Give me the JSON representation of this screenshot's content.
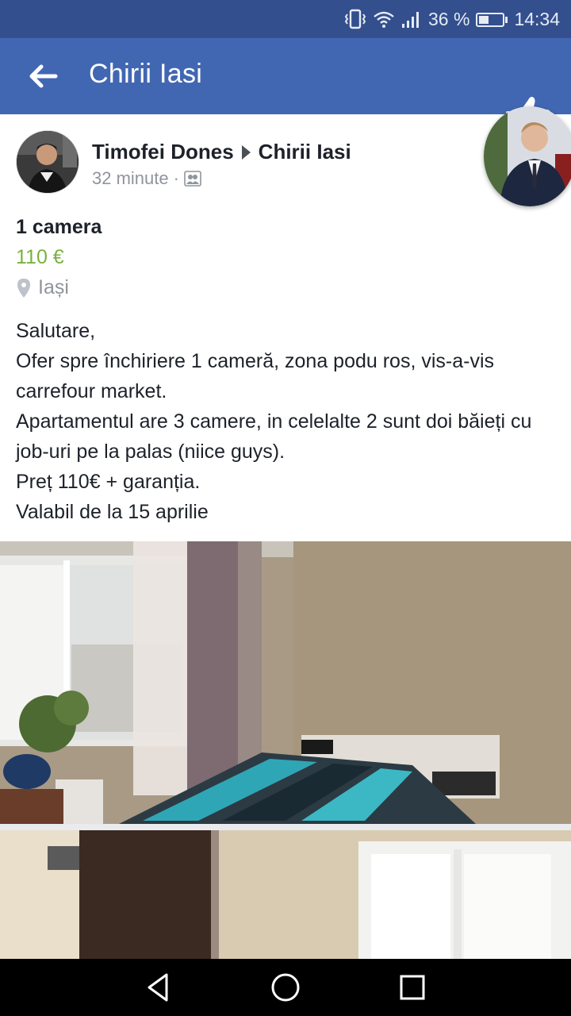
{
  "status_bar": {
    "battery_text": "36 %",
    "battery_level": 0.36,
    "time": "14:34"
  },
  "app_bar": {
    "title": "Chirii Iasi"
  },
  "post": {
    "author": "Timofei Dones",
    "group": "Chirii Iasi",
    "timestamp": "32 minute",
    "separator": "·",
    "privacy_icon": "group-icon"
  },
  "listing": {
    "title": "1 camera",
    "price": "110 €",
    "location": "Iași",
    "price_color": "#78b23f"
  },
  "body_lines": [
    "Salutare,",
    "Ofer spre închiriere 1 cameră, zona podu ros, vis-a-vis carrefour market.",
    "Apartamentul are 3 camere, in celelalte 2 sunt doi băieți cu job-uri pe la palas (niice guys).",
    "Preț 110€ + garanția.",
    "Valabil de la 15 aprilie"
  ],
  "colors": {
    "status_bar": "#334f8d",
    "app_bar": "#4267b2",
    "text": "#1d2129",
    "muted": "#90949c"
  },
  "nav": {
    "back_icon": "triangle-back-icon",
    "home_icon": "circle-home-icon",
    "recents_icon": "square-recents-icon"
  }
}
